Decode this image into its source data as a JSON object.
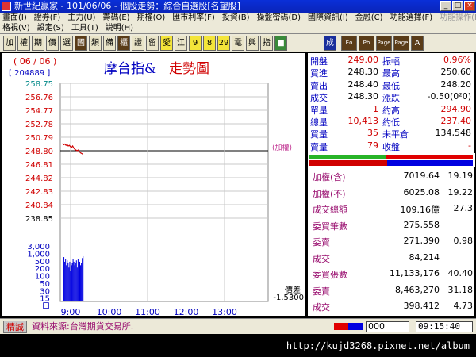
{
  "window": {
    "title": "新世紀贏家 - 101/06/06 - 個股走勢：綜合自選股[名望股]",
    "buttons": [
      "_",
      "□",
      "×"
    ]
  },
  "menu": {
    "row1": [
      "畫面(I)",
      "證券(F)",
      "主力(U)",
      "籌碼(E)",
      "期權(O)",
      "匯市利率(F)",
      "投資(B)",
      "操盤密碼(D)",
      "國際資訊(I)",
      "金融(C)",
      "功能選擇(F)"
    ],
    "row1_disabled": [
      "功能操作(E)"
    ],
    "row2": [
      "格視(V)",
      "設定(S)",
      "工具(T)",
      "說明(H)"
    ]
  },
  "toolbar": {
    "buttons": [
      {
        "label": "加",
        "style": ""
      },
      {
        "label": "權",
        "style": ""
      },
      {
        "label": "期",
        "style": ""
      },
      {
        "label": "價",
        "style": ""
      },
      {
        "label": "選",
        "style": ""
      },
      {
        "label": "國",
        "style": "dark"
      },
      {
        "label": "類",
        "style": ""
      },
      {
        "label": "備",
        "style": ""
      },
      {
        "label": "櫃",
        "style": "dark"
      },
      {
        "label": "證",
        "style": ""
      },
      {
        "label": "留",
        "style": ""
      },
      {
        "label": "愛",
        "style": "yel"
      },
      {
        "label": "江",
        "style": ""
      },
      {
        "label": "9",
        "style": "yel"
      },
      {
        "label": "8",
        "style": "yel"
      },
      {
        "label": "29",
        "style": "yel"
      },
      {
        "label": "電",
        "style": ""
      },
      {
        "label": "興",
        "style": ""
      },
      {
        "label": "指",
        "style": ""
      },
      {
        "label": "■",
        "style": "grn"
      },
      {
        "label": "成",
        "style": "blu"
      },
      {
        "label": "Eo",
        "style": "dark"
      },
      {
        "label": "Ph",
        "style": "dark"
      },
      {
        "label": "Page",
        "style": "dark"
      },
      {
        "label": "Page",
        "style": "dark"
      },
      {
        "label": "A",
        "style": "dark"
      }
    ]
  },
  "chart": {
    "date": "( 06 / 06 )",
    "code": "[ 204889 ]",
    "title_part1": "摩台指&",
    "title_part2": "走勢圖",
    "ref_label": "(加權)",
    "diff_label": "價差",
    "diff_value": "-1.5300"
  },
  "chart_data": {
    "type": "line",
    "title": "摩台指& 走勢圖",
    "y_ticks": [
      "258.75",
      "256.76",
      "254.77",
      "252.78",
      "250.79",
      "248.80",
      "246.81",
      "244.82",
      "242.83",
      "240.84",
      "238.85"
    ],
    "ylim": [
      238.85,
      258.75
    ],
    "reference": 248.8,
    "x_ticks": [
      "9:00",
      "10:00",
      "11:00",
      "12:00",
      "13:00"
    ],
    "price_series": {
      "time": [
        "8:45",
        "8:46",
        "8:47",
        "8:48",
        "8:49",
        "8:50",
        "8:51",
        "8:52",
        "8:53",
        "8:54",
        "8:55",
        "8:56",
        "8:57",
        "8:58",
        "8:59",
        "9:00",
        "9:01",
        "9:02",
        "9:03"
      ],
      "values": [
        249.9,
        249.7,
        249.8,
        249.6,
        249.7,
        249.5,
        249.6,
        249.4,
        249.3,
        249.5,
        249.2,
        249.0,
        248.9,
        248.8,
        248.9,
        248.7,
        248.5,
        248.4,
        248.3
      ]
    },
    "volume_ticks": [
      "3,000",
      "1,000",
      "500",
      "200",
      "100",
      "50",
      "30",
      "15",
      "口"
    ],
    "volume_series": {
      "values": [
        1600,
        1100,
        700,
        900,
        500,
        800,
        600,
        400,
        700,
        300,
        500,
        600,
        900,
        700,
        500,
        600,
        800,
        400,
        900,
        300,
        700,
        500,
        600,
        1000,
        1200
      ]
    }
  },
  "quote": {
    "rows": [
      {
        "l1": "開盤",
        "v1": "249.00",
        "c1": "red",
        "l2": "振幅",
        "v2": "0.96%",
        "c2": "red"
      },
      {
        "l1": "買進",
        "v1": "248.30",
        "c1": "blk",
        "l2": "最高",
        "v2": "250.60",
        "c2": "blk"
      },
      {
        "l1": "賣出",
        "v1": "248.40",
        "c1": "blk",
        "l2": "最低",
        "v2": "248.20",
        "c2": "blk"
      },
      {
        "l1": "成交",
        "v1": "248.30",
        "c1": "blk",
        "l2": "漲跌",
        "v2": "-0.50(0²0)",
        "c2": "blk"
      },
      {
        "l1": "單量",
        "v1": "1",
        "c1": "red",
        "l2": "約高",
        "v2": "294.90",
        "c2": "red"
      },
      {
        "l1": "總量",
        "v1": "10,413",
        "c1": "red",
        "l2": "約低",
        "v2": "237.40",
        "c2": "red"
      },
      {
        "l1": "買量",
        "v1": "35",
        "c1": "red",
        "l2": "未平倉",
        "v2": "134,548",
        "c2": "blk"
      },
      {
        "l1": "賣量",
        "v1": "79",
        "c1": "red",
        "l2": "收盤",
        "v2": "-",
        "c2": "red"
      }
    ],
    "stats": [
      {
        "label": "加權(含)",
        "v1": "7019.64",
        "v2": "19.19"
      },
      {
        "label": "加權(不)",
        "v1": "6025.08",
        "v2": "19.22"
      },
      {
        "label": "成交總額",
        "v1": "109.16億",
        "v2": "27.3"
      },
      {
        "label": "委買筆數",
        "v1": "275,558",
        "v2": ""
      },
      {
        "label": "委賣",
        "v1": "271,390",
        "v2": "0.98"
      },
      {
        "label": "成交",
        "v1": "84,214",
        "v2": ""
      },
      {
        "label": "委買張數",
        "v1": "11,133,176",
        "v2": "40.40"
      },
      {
        "label": "委賣",
        "v1": "8,463,270",
        "v2": "31.18"
      },
      {
        "label": "成交",
        "v1": "398,412",
        "v2": "4.73"
      }
    ]
  },
  "status": {
    "tag": "精誠",
    "source": "資料來源:台灣期貨交易所.",
    "input_value": "000",
    "time": "09:15:40"
  },
  "watermark": {
    "url": "http://kujd3268.pixnet.net/album"
  },
  "colors": {
    "price_line": "#d00000",
    "volume_bar": "#0000e0",
    "ref_line": "#000000",
    "grid": "#c8c8c8",
    "axis_text": "#d00000"
  }
}
